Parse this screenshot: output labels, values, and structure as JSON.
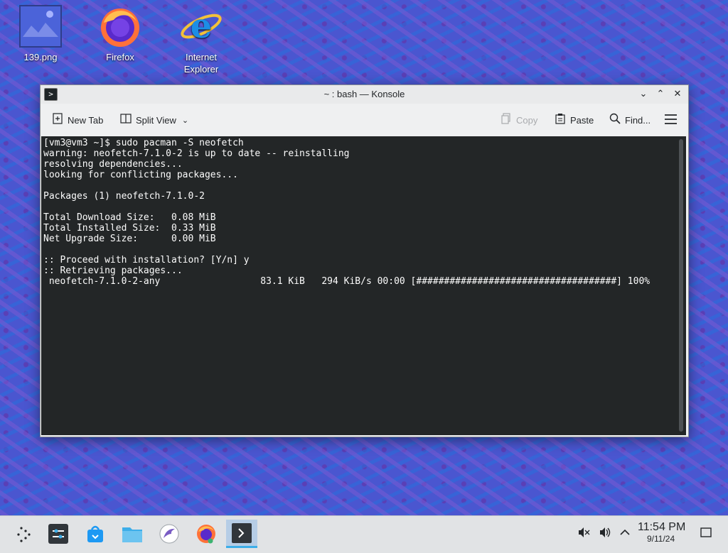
{
  "desktop": {
    "icons": [
      {
        "label": "139.png",
        "icon": "image-file-icon"
      },
      {
        "label": "Firefox",
        "icon": "firefox-icon"
      },
      {
        "label": "Internet Explorer",
        "icon": "internet-explorer-icon"
      }
    ]
  },
  "window": {
    "title": "~ : bash — Konsole",
    "toolbar": {
      "new_tab": "New Tab",
      "split_view": "Split View",
      "copy": "Copy",
      "paste": "Paste",
      "find": "Find..."
    },
    "terminal": {
      "lines": [
        "[vm3@vm3 ~]$ sudo pacman -S neofetch",
        "warning: neofetch-7.1.0-2 is up to date -- reinstalling",
        "resolving dependencies...",
        "looking for conflicting packages...",
        "",
        "Packages (1) neofetch-7.1.0-2",
        "",
        "Total Download Size:   0.08 MiB",
        "Total Installed Size:  0.33 MiB",
        "Net Upgrade Size:      0.00 MiB",
        "",
        ":: Proceed with installation? [Y/n] y",
        ":: Retrieving packages...",
        " neofetch-7.1.0-2-any                  83.1 KiB   294 KiB/s 00:00 [####################################] 100%"
      ]
    }
  },
  "taskbar": {
    "apps": [
      {
        "name": "application-launcher",
        "icon": "kde-launcher-icon"
      },
      {
        "name": "system-settings",
        "icon": "settings-sliders-icon"
      },
      {
        "name": "discover",
        "icon": "store-bag-icon"
      },
      {
        "name": "file-manager",
        "icon": "folder-icon"
      },
      {
        "name": "app-bird",
        "icon": "bird-icon"
      },
      {
        "name": "firefox",
        "icon": "firefox-icon"
      },
      {
        "name": "konsole",
        "icon": "terminal-icon"
      }
    ],
    "clock": {
      "time": "11:54 PM",
      "date": "9/11/24"
    }
  },
  "colors": {
    "terminal_bg": "#232627",
    "terminal_fg": "#fcfcfc",
    "active_task_accent": "#3daee9"
  }
}
